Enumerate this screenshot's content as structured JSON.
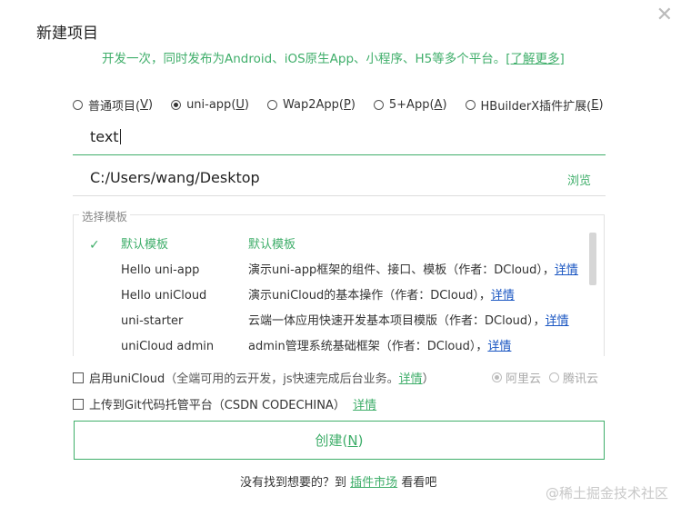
{
  "dialog": {
    "title": "新建项目",
    "subtitle_prefix": "开发一次，同时发布为Android、iOS原生App、小程序、H5等多个平台。",
    "subtitle_link": "[了解更多]",
    "close_glyph": "✕"
  },
  "project_types": [
    {
      "label": "普通项目(",
      "key": "V",
      "suffix": ")",
      "selected": false
    },
    {
      "label": "uni-app(",
      "key": "U",
      "suffix": ")",
      "selected": true
    },
    {
      "label": "Wap2App(",
      "key": "P",
      "suffix": ")",
      "selected": false
    },
    {
      "label": "5+App(",
      "key": "A",
      "suffix": ")",
      "selected": false
    },
    {
      "label": "HBuilderX插件扩展(",
      "key": "E",
      "suffix": ")",
      "selected": false
    }
  ],
  "name_input": {
    "value": "text"
  },
  "path_input": {
    "value": "C:/Users/wang/Desktop",
    "browse_label": "浏览"
  },
  "templates": {
    "legend": "选择模板",
    "rows": [
      {
        "check": "✓",
        "name": "默认模板",
        "desc": "默认模板",
        "link": "",
        "selected": true
      },
      {
        "check": "",
        "name": "Hello uni-app",
        "desc": "演示uni-app框架的组件、接口、模板（作者：DCloud），",
        "link": "详情",
        "selected": false
      },
      {
        "check": "",
        "name": "Hello uniCloud",
        "desc": "演示uniCloud的基本操作（作者：DCloud），",
        "link": "详情",
        "selected": false
      },
      {
        "check": "",
        "name": "uni-starter",
        "desc": "云端一体应用快速开发基本项目模版（作者：DCloud），",
        "link": "详情",
        "selected": false
      },
      {
        "check": "",
        "name": "uniCloud admin",
        "desc": "admin管理系统基础框架（作者：DCloud），",
        "link": "详情",
        "selected": false
      }
    ]
  },
  "unicloud_option": {
    "label": "启用uniCloud",
    "hint": "（全端可用的云开发，js快速完成后台业务。",
    "link": "详情",
    "hint_end": "）",
    "providers": [
      {
        "label": "阿里云",
        "selected": true
      },
      {
        "label": "腾讯云",
        "selected": false
      }
    ]
  },
  "git_option": {
    "label": "上传到Git代码托管平台（CSDN CODECHINA）",
    "link": "详情"
  },
  "create_button": {
    "label": "创建(",
    "key": "N",
    "suffix": ")"
  },
  "footer": {
    "prefix": "没有找到想要的？到",
    "link": "插件市场",
    "suffix": "看看吧"
  },
  "watermark": "@稀土掘金技术社区",
  "colors": {
    "accent": "#3fae6a",
    "link_blue": "#1a56c2"
  }
}
